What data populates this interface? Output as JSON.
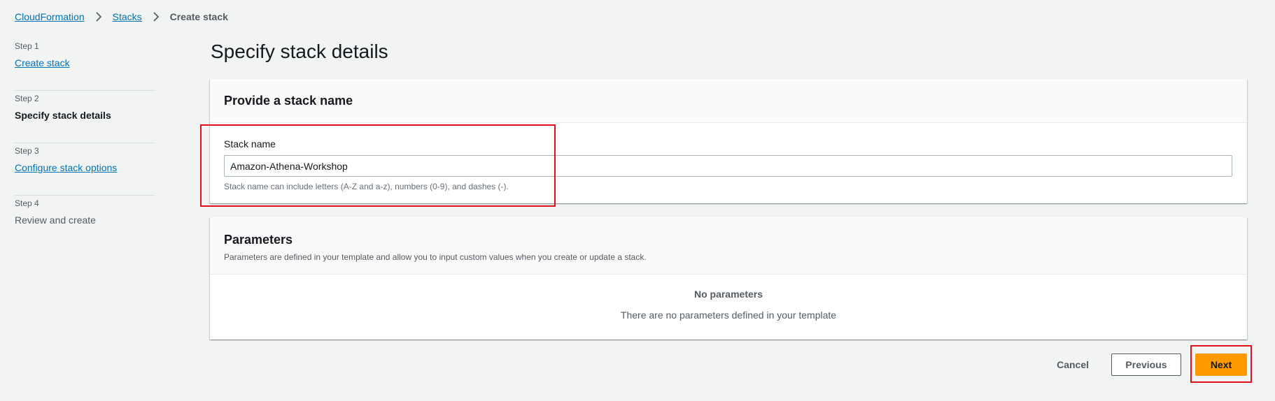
{
  "breadcrumb": {
    "items": [
      "CloudFormation",
      "Stacks"
    ],
    "current": "Create stack"
  },
  "steps": [
    {
      "num": "Step 1",
      "title": "Create stack",
      "state": "link"
    },
    {
      "num": "Step 2",
      "title": "Specify stack details",
      "state": "active"
    },
    {
      "num": "Step 3",
      "title": "Configure stack options",
      "state": "link"
    },
    {
      "num": "Step 4",
      "title": "Review and create",
      "state": "disabled"
    }
  ],
  "page": {
    "title": "Specify stack details"
  },
  "stack_name_section": {
    "heading": "Provide a stack name",
    "field_label": "Stack name",
    "value": "Amazon-Athena-Workshop",
    "hint": "Stack name can include letters (A-Z and a-z), numbers (0-9), and dashes (-)."
  },
  "parameters_section": {
    "heading": "Parameters",
    "description": "Parameters are defined in your template and allow you to input custom values when you create or update a stack.",
    "empty_title": "No parameters",
    "empty_desc": "There are no parameters defined in your template"
  },
  "actions": {
    "cancel": "Cancel",
    "previous": "Previous",
    "next": "Next"
  },
  "colors": {
    "link": "#0073bb",
    "primary_button": "#ff9900",
    "highlight_box": "#e0101a",
    "page_background": "#f2f3f3"
  },
  "icons": {
    "breadcrumb_separator": "chevron-right-icon"
  }
}
